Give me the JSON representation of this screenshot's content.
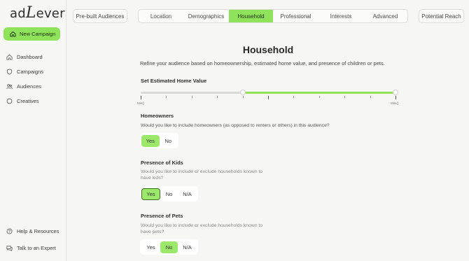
{
  "app": {
    "logo_prefix": "ad",
    "logo_big": "L",
    "logo_suffix": "ever"
  },
  "sidebar": {
    "new_campaign": "New Campaign",
    "items": [
      {
        "label": "Dashboard",
        "icon": "home-icon"
      },
      {
        "label": "Campaigns",
        "icon": "shield-icon"
      },
      {
        "label": "Audiences",
        "icon": "users-icon"
      },
      {
        "label": "Creatives",
        "icon": "circle-icon"
      }
    ],
    "bottom": [
      {
        "label": "Help & Resources",
        "icon": "help-icon"
      },
      {
        "label": "Talk to an Expert",
        "icon": "chat-icon"
      }
    ]
  },
  "topbar": {
    "prebuilt": "Pre-built Audiences",
    "tabs": [
      "Location",
      "Demographics",
      "Household",
      "Professional",
      "Interests",
      "Advanced"
    ],
    "active_tab": "Household",
    "reach": "Potential Reach"
  },
  "main": {
    "title": "Household",
    "subtitle": "Refine your audience based on homeownership, estimated home value, and presence of children or pets.",
    "home_value": {
      "label": "Set Estimated Home Value",
      "min_label": "Min()",
      "max_label": "Max()",
      "range_start": 0.4,
      "range_end": 1.0
    },
    "homeowners": {
      "label": "Homeowners",
      "question": "Would you like to include homeowners (as opposed to renters or others) in this audience?",
      "options": [
        "Yes",
        "No"
      ],
      "selected": "Yes"
    },
    "kids": {
      "label": "Presence of Kids",
      "question_line1": "Would you like to include or exclude households known to",
      "question_line2": "have kids?",
      "options": [
        "Yes",
        "No",
        "N/A"
      ],
      "selected": "Yes"
    },
    "pets": {
      "label": "Presence of Pets",
      "question_line1": "Would you like to include or exclude households known to",
      "question_line2": "have pets?",
      "options": [
        "Yes",
        "No",
        "N/A"
      ],
      "selected": "No"
    }
  },
  "colors": {
    "accent": "#8ee35a",
    "background": "#f6f6f4"
  }
}
